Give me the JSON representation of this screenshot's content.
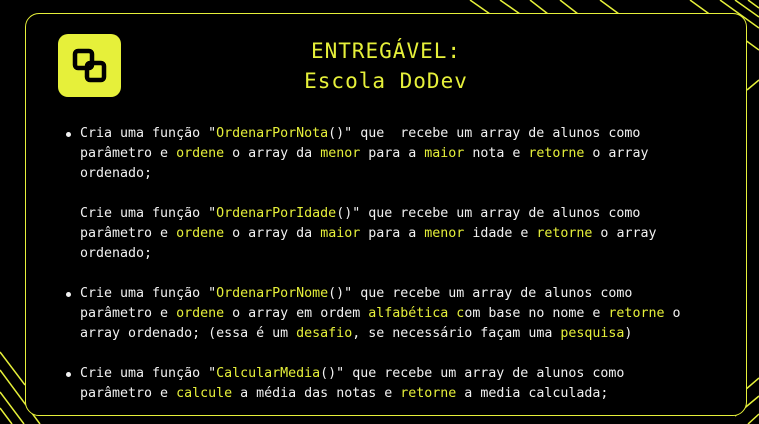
{
  "header": {
    "title_line1": "ENTREGÁVEL:",
    "title_line2": "Escola DoDev"
  },
  "logo": {
    "icon": "dodev-logo-icon",
    "color": "#e6f03a"
  },
  "colors": {
    "accent": "#e6f03a",
    "background": "#000000",
    "text": "#f2f2f2"
  },
  "items": [
    {
      "bullet": true,
      "lines": [
        [
          {
            "t": "Cria uma função \""
          },
          {
            "t": "OrdenarPorNota",
            "h": true
          },
          {
            "t": "()\" que  recebe um array de alunos como"
          }
        ],
        [
          {
            "t": "parâmetro e "
          },
          {
            "t": "ordene",
            "h": true
          },
          {
            "t": " o array da "
          },
          {
            "t": "menor",
            "h": true
          },
          {
            "t": " para a "
          },
          {
            "t": "maior",
            "h": true
          },
          {
            "t": " nota e "
          },
          {
            "t": "retorne",
            "h": true
          },
          {
            "t": " o array"
          }
        ],
        [
          {
            "t": "ordenado;"
          }
        ]
      ]
    },
    {
      "bullet": false,
      "lines": [
        [
          {
            "t": "Crie uma função \""
          },
          {
            "t": "OrdenarPorIdade",
            "h": true
          },
          {
            "t": "()\" que recebe um array de alunos como"
          }
        ],
        [
          {
            "t": "parâmetro e "
          },
          {
            "t": "ordene",
            "h": true
          },
          {
            "t": " o array da "
          },
          {
            "t": "maior",
            "h": true
          },
          {
            "t": " para a "
          },
          {
            "t": "menor",
            "h": true
          },
          {
            "t": " idade e "
          },
          {
            "t": "retorne",
            "h": true
          },
          {
            "t": " o array"
          }
        ],
        [
          {
            "t": "ordenado;"
          }
        ]
      ]
    },
    {
      "bullet": true,
      "lines": [
        [
          {
            "t": "Crie uma função \""
          },
          {
            "t": "OrdenarPorNome",
            "h": true
          },
          {
            "t": "()\" que recebe um array de alunos como"
          }
        ],
        [
          {
            "t": "parâmetro e "
          },
          {
            "t": "ordene",
            "h": true
          },
          {
            "t": " o array em ordem "
          },
          {
            "t": "alfabética c",
            "h": true
          },
          {
            "t": "om base no nome e "
          },
          {
            "t": "retorne",
            "h": true
          },
          {
            "t": " o"
          }
        ],
        [
          {
            "t": "array ordenado; (essa é um "
          },
          {
            "t": "desafio",
            "h": true
          },
          {
            "t": ", se necessário façam uma "
          },
          {
            "t": "pesquisa",
            "h": true
          },
          {
            "t": ")"
          }
        ]
      ]
    },
    {
      "bullet": true,
      "lines": [
        [
          {
            "t": "Crie uma função \""
          },
          {
            "t": "CalcularMedia",
            "h": true
          },
          {
            "t": "()\" que recebe um array de alunos como"
          }
        ],
        [
          {
            "t": "parâmetro e "
          },
          {
            "t": "calcule",
            "h": true
          },
          {
            "t": " a média das notas e "
          },
          {
            "t": "retorne",
            "h": true
          },
          {
            "t": " a media calculada;"
          }
        ]
      ]
    }
  ]
}
